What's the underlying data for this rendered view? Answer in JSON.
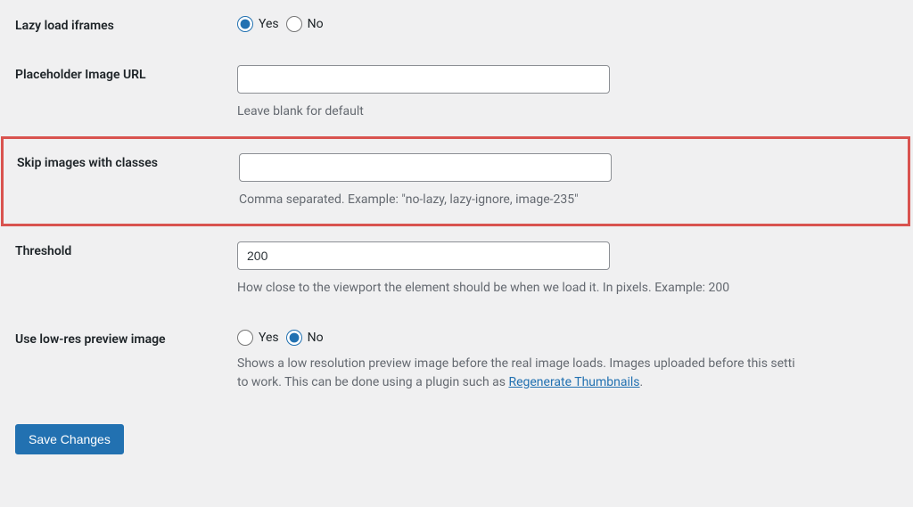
{
  "settings": {
    "lazy_iframes": {
      "label": "Lazy load iframes",
      "yes": "Yes",
      "no": "No",
      "selected": "yes"
    },
    "placeholder_url": {
      "label": "Placeholder Image URL",
      "value": "",
      "description": "Leave blank for default"
    },
    "skip_classes": {
      "label": "Skip images with classes",
      "value": "",
      "description": "Comma separated. Example: \"no-lazy, lazy-ignore, image-235\""
    },
    "threshold": {
      "label": "Threshold",
      "value": "200",
      "description": "How close to the viewport the element should be when we load it. In pixels. Example: 200"
    },
    "lowres_preview": {
      "label": "Use low-res preview image",
      "yes": "Yes",
      "no": "No",
      "selected": "no",
      "description_before": "Shows a low resolution preview image before the real image loads. Images uploaded before this setti",
      "description_middle": "to work. This can be done using a plugin such as ",
      "link_text": "Regenerate Thumbnails",
      "description_after": "."
    }
  },
  "save_button": "Save Changes"
}
